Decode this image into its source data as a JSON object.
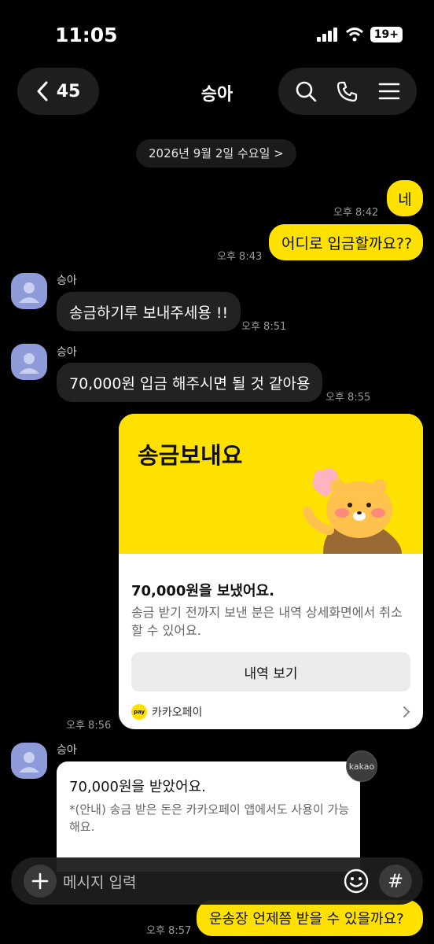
{
  "status_bar": {
    "time": "11:05",
    "battery": "19+"
  },
  "header": {
    "back_count": "45",
    "title": "승아"
  },
  "date_divider": "2026년 9월 2일 수요일 >",
  "messages": [
    {
      "from": "me",
      "text": "네",
      "time": "오후 8:42"
    },
    {
      "from": "me",
      "text": "어디로 입금할까요??",
      "time": "오후 8:43"
    },
    {
      "from": "other",
      "sender": "승아",
      "text": "송금하기루 보내주세용 !!",
      "time": "오후 8:51"
    },
    {
      "from": "other",
      "sender": "승아",
      "text": "70,000원 입금 해주시면 될 것 같아용",
      "time": "오후 8:55"
    }
  ],
  "transfer_card": {
    "title": "송금보내요",
    "amount_text": "70,000원을 보냈어요.",
    "description": "송금 받기 전까지 보낸 분은 내역 상세화면에서 취소할 수 있어요.",
    "button_label": "내역 보기",
    "brand": "카카오페이",
    "pay_label": "pay",
    "time": "오후 8:56"
  },
  "received_card": {
    "sender": "승아",
    "title": "70,000원을 받았어요.",
    "description": "*(안내) 송금 받은 돈은 카카오페이 앱에서도 사용이 가능해요.",
    "badge": "kakao"
  },
  "last_message": {
    "text": "운송장 언제쯤 받을 수 있을까요?",
    "time": "오후 8:57"
  },
  "input": {
    "placeholder": "메시지 입력"
  },
  "colors": {
    "accent": "#ffe100",
    "background": "#000000",
    "other_bubble": "#222222",
    "avatar": "#8f9bd8"
  }
}
